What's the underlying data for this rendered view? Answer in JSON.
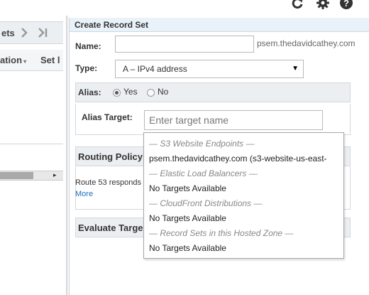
{
  "toolbar": {
    "icons": [
      "refresh-icon",
      "gear-icon",
      "help-icon"
    ]
  },
  "left": {
    "header_text": "ets",
    "header_icons": [
      "chevron-right-icon",
      "last-page-icon"
    ],
    "col1": "ation",
    "col2": "Set l"
  },
  "dialog": {
    "title": "Create Record Set",
    "name_label": "Name:",
    "name_value": "",
    "domain_suffix": "psem.thedavidcathey.com",
    "type_label": "Type:",
    "type_value": "A – IPv4 address",
    "alias_label": "Alias:",
    "alias_yes": "Yes",
    "alias_no": "No",
    "alias_selected": "Yes",
    "alias_target_label": "Alias Target:",
    "alias_target_placeholder": "Enter target name",
    "routing_title": "Routing Policy",
    "routing_text": "Route 53 responds",
    "routing_more": "More",
    "evaluate_title": "Evaluate Targe"
  },
  "dropdown": {
    "items": [
      {
        "kind": "group",
        "text": "— S3 Website Endpoints —"
      },
      {
        "kind": "option",
        "text": "psem.thedavidcathey.com (s3-website-us-east-"
      },
      {
        "kind": "group",
        "text": "— Elastic Load Balancers —"
      },
      {
        "kind": "option",
        "text": "No Targets Available"
      },
      {
        "kind": "group",
        "text": "— CloudFront Distributions —"
      },
      {
        "kind": "option",
        "text": "No Targets Available"
      },
      {
        "kind": "group",
        "text": "— Record Sets in this Hosted Zone —"
      },
      {
        "kind": "option",
        "text": "No Targets Available"
      }
    ]
  },
  "colors": {
    "link": "#1a6fbf",
    "title_bar": "#e9f1f9",
    "section_bar": "#eceff2"
  }
}
